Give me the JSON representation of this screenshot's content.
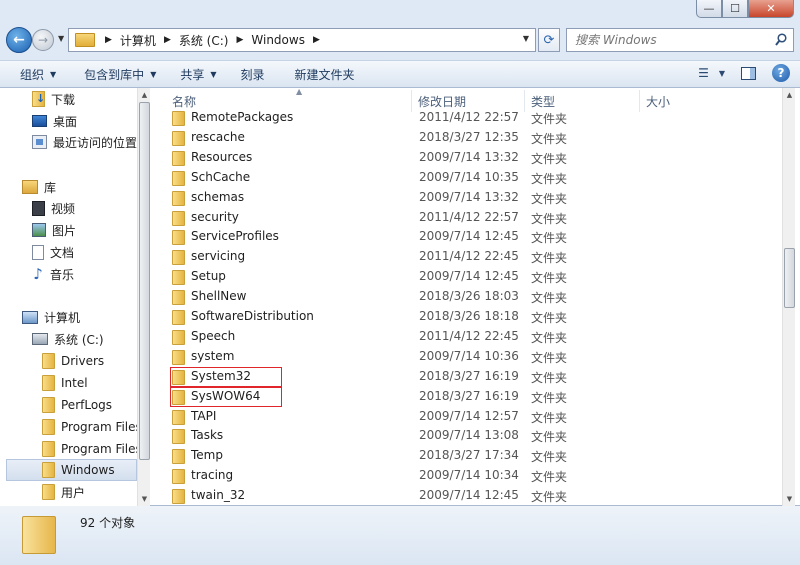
{
  "window": {
    "min_label": "—",
    "max_label": "☐",
    "close_label": "✕"
  },
  "address": {
    "crumbs": [
      "计算机",
      "系统 (C:)",
      "Windows"
    ],
    "search_placeholder": "搜索 Windows"
  },
  "toolbar": {
    "items": [
      {
        "label": "组织",
        "dropdown": true
      },
      {
        "label": "包含到库中",
        "dropdown": true
      },
      {
        "label": "共享",
        "dropdown": true
      },
      {
        "label": "刻录",
        "dropdown": false
      },
      {
        "label": "新建文件夹",
        "dropdown": false
      }
    ]
  },
  "nav": {
    "items": [
      {
        "label": "下载",
        "icon": "download-folder-icon"
      },
      {
        "label": "桌面",
        "icon": "desktop-icon"
      },
      {
        "label": "最近访问的位置",
        "icon": "recent-places-icon"
      },
      {
        "label": "库",
        "icon": "libraries-icon"
      },
      {
        "label": "视频",
        "icon": "video-icon"
      },
      {
        "label": "图片",
        "icon": "pictures-icon"
      },
      {
        "label": "文档",
        "icon": "documents-icon"
      },
      {
        "label": "音乐",
        "icon": "music-icon"
      },
      {
        "label": "计算机",
        "icon": "computer-icon"
      },
      {
        "label": "系统 (C:)",
        "icon": "drive-icon"
      },
      {
        "label": "Drivers",
        "icon": "folder-icon"
      },
      {
        "label": "Intel",
        "icon": "folder-icon"
      },
      {
        "label": "PerfLogs",
        "icon": "folder-icon"
      },
      {
        "label": "Program Files",
        "icon": "folder-icon"
      },
      {
        "label": "Program Files",
        "icon": "folder-icon"
      },
      {
        "label": "Windows",
        "icon": "folder-icon",
        "selected": true
      },
      {
        "label": "用户",
        "icon": "folder-icon"
      }
    ]
  },
  "columns": {
    "name": "名称",
    "date": "修改日期",
    "type": "类型",
    "size": "大小"
  },
  "files": [
    {
      "name": "RemotePackages",
      "date": "2011/4/12 22:57",
      "type": "文件夹"
    },
    {
      "name": "rescache",
      "date": "2018/3/27 12:35",
      "type": "文件夹"
    },
    {
      "name": "Resources",
      "date": "2009/7/14 13:32",
      "type": "文件夹"
    },
    {
      "name": "SchCache",
      "date": "2009/7/14 10:35",
      "type": "文件夹"
    },
    {
      "name": "schemas",
      "date": "2009/7/14 13:32",
      "type": "文件夹"
    },
    {
      "name": "security",
      "date": "2011/4/12 22:57",
      "type": "文件夹"
    },
    {
      "name": "ServiceProfiles",
      "date": "2009/7/14 12:45",
      "type": "文件夹"
    },
    {
      "name": "servicing",
      "date": "2011/4/12 22:45",
      "type": "文件夹"
    },
    {
      "name": "Setup",
      "date": "2009/7/14 12:45",
      "type": "文件夹"
    },
    {
      "name": "ShellNew",
      "date": "2018/3/26 18:03",
      "type": "文件夹"
    },
    {
      "name": "SoftwareDistribution",
      "date": "2018/3/26 18:18",
      "type": "文件夹"
    },
    {
      "name": "Speech",
      "date": "2011/4/12 22:45",
      "type": "文件夹"
    },
    {
      "name": "system",
      "date": "2009/7/14 10:36",
      "type": "文件夹"
    },
    {
      "name": "System32",
      "date": "2018/3/27 16:19",
      "type": "文件夹",
      "highlighted": true
    },
    {
      "name": "SysWOW64",
      "date": "2018/3/27 16:19",
      "type": "文件夹",
      "highlighted": true
    },
    {
      "name": "TAPI",
      "date": "2009/7/14 12:57",
      "type": "文件夹"
    },
    {
      "name": "Tasks",
      "date": "2009/7/14 13:08",
      "type": "文件夹"
    },
    {
      "name": "Temp",
      "date": "2018/3/27 17:34",
      "type": "文件夹"
    },
    {
      "name": "tracing",
      "date": "2009/7/14 10:34",
      "type": "文件夹"
    },
    {
      "name": "twain_32",
      "date": "2009/7/14 12:45",
      "type": "文件夹"
    }
  ],
  "status": {
    "count_text": "92 个对象"
  },
  "colors": {
    "highlight_border": "#e0262b",
    "selection_bg": "#d4dfee"
  }
}
